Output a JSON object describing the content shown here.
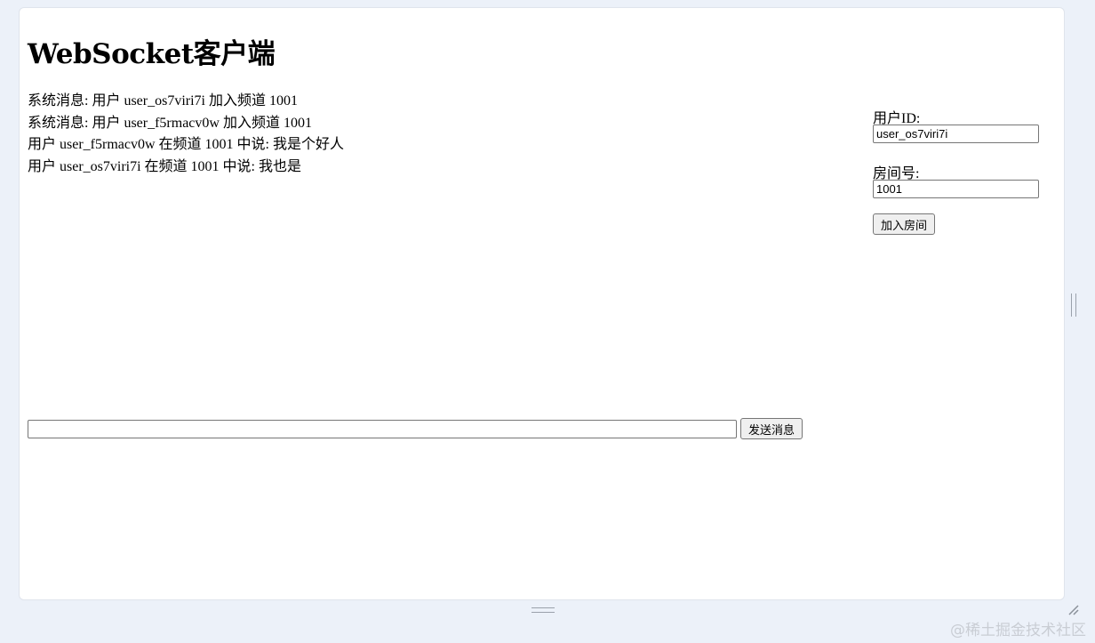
{
  "page": {
    "title": "WebSocket客户端"
  },
  "messages": [
    "系统消息: 用户 user_os7viri7i 加入频道 1001",
    "系统消息: 用户 user_f5rmacv0w 加入频道 1001",
    "用户 user_f5rmacv0w 在频道 1001 中说: 我是个好人",
    "用户 user_os7viri7i 在频道 1001 中说: 我也是"
  ],
  "composer": {
    "input_value": "",
    "send_label": "发送消息"
  },
  "sidebar": {
    "user_id_label": "用户ID:",
    "user_id_value": "user_os7viri7i",
    "room_label": "房间号:",
    "room_value": "1001",
    "join_label": "加入房间"
  },
  "watermark": "@稀土掘金技术社区"
}
